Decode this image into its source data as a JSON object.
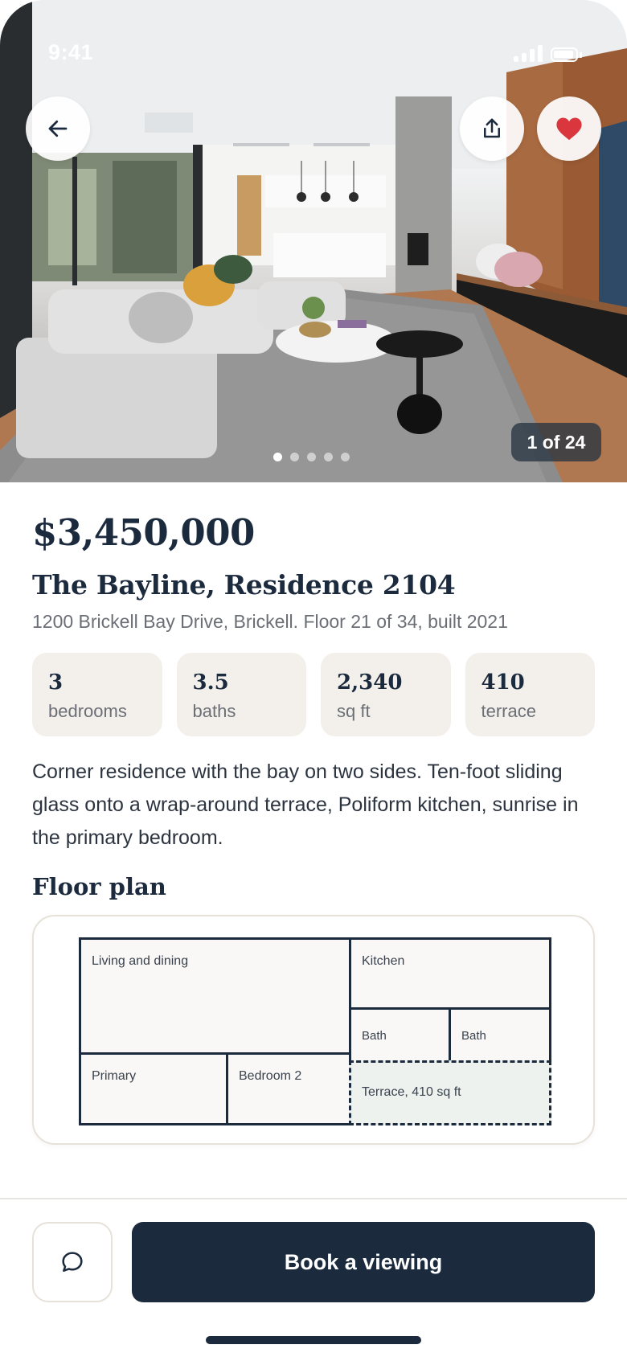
{
  "status": {
    "time": "9:41"
  },
  "hero": {
    "back_icon": "arrow-left-icon",
    "share_icon": "share-icon",
    "favorite_icon": "heart-icon",
    "photo_index": 1,
    "photo_count_label": "1 of 24",
    "dots_total": 5,
    "dots_active": 0
  },
  "listing": {
    "price": "$3,450,000",
    "title": "The Bayline, Residence 2104",
    "address": "1200 Brickell Bay Drive, Brickell. Floor 21 of 34, built 2021",
    "stats": [
      {
        "value": "3",
        "label": "bedrooms"
      },
      {
        "value": "3.5",
        "label": "baths"
      },
      {
        "value": "2,340",
        "label": "sq ft"
      },
      {
        "value": "410",
        "label": "terrace"
      }
    ],
    "description": "Corner residence with the bay on two sides. Ten-foot sliding glass onto a wrap-around terrace, Poliform kitchen, sunrise in the primary bedroom."
  },
  "floor_plan": {
    "heading": "Floor plan",
    "rooms": {
      "living": "Living and dining",
      "kitchen": "Kitchen",
      "bath_1": "Bath",
      "bath_2": "Bath",
      "primary": "Primary",
      "bedroom_2": "Bedroom 2",
      "terrace": "Terrace, 410 sq ft"
    }
  },
  "actions": {
    "chat_icon": "chat-bubble-icon",
    "book_label": "Book a viewing"
  },
  "colors": {
    "navy": "#1c2a3e",
    "favorite": "#d9363e",
    "stat_bg": "#f3f0eb",
    "terrace_fill": "#eef2ef"
  }
}
